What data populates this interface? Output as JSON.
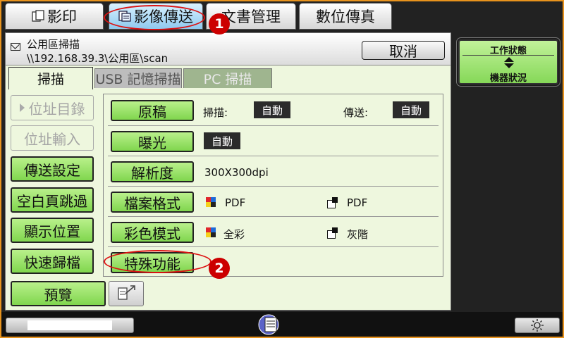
{
  "top_tabs": [
    {
      "label": "影印",
      "icon": "copy-icon"
    },
    {
      "label": "影像傳送",
      "icon": "image-send-icon",
      "active": true
    },
    {
      "label": "文書管理"
    },
    {
      "label": "數位傳真"
    }
  ],
  "header": {
    "destination_name": "公用區掃描",
    "destination_path": "\\\\192.168.39.3\\公用區\\scan",
    "cancel_label": "取消"
  },
  "mode_tabs": [
    {
      "label": "掃描",
      "active": true
    },
    {
      "label": "USB 記憶掃描",
      "disabled": true
    },
    {
      "label": "PC 掃描",
      "disabled": true
    }
  ],
  "left_buttons": [
    {
      "label": "位址目錄",
      "disabled": true
    },
    {
      "label": "位址輸入",
      "disabled": true
    },
    {
      "label": "傳送設定"
    },
    {
      "label": "空白頁跳過"
    },
    {
      "label": "顯示位置"
    },
    {
      "label": "快速歸檔"
    }
  ],
  "settings": {
    "original": {
      "label": "原稿",
      "scan_label": "掃描:",
      "scan_value": "自動",
      "send_label": "傳送:",
      "send_value": "自動"
    },
    "exposure": {
      "label": "曝光",
      "value": "自動"
    },
    "resolution": {
      "label": "解析度",
      "value": "300X300dpi"
    },
    "file_format": {
      "label": "檔案格式",
      "color_value": "PDF",
      "mono_value": "PDF"
    },
    "color_mode": {
      "label": "彩色模式",
      "color_value": "全彩",
      "mono_value": "灰階"
    },
    "special": {
      "label": "特殊功能"
    }
  },
  "preview_label": "預覽",
  "status": {
    "top": "工作狀態",
    "bottom": "機器狀況"
  },
  "callouts": [
    "1",
    "2"
  ],
  "colors": {
    "accent_green": "#80d64e",
    "frame_orange": "#e8931d",
    "callout_red": "#c00000"
  }
}
